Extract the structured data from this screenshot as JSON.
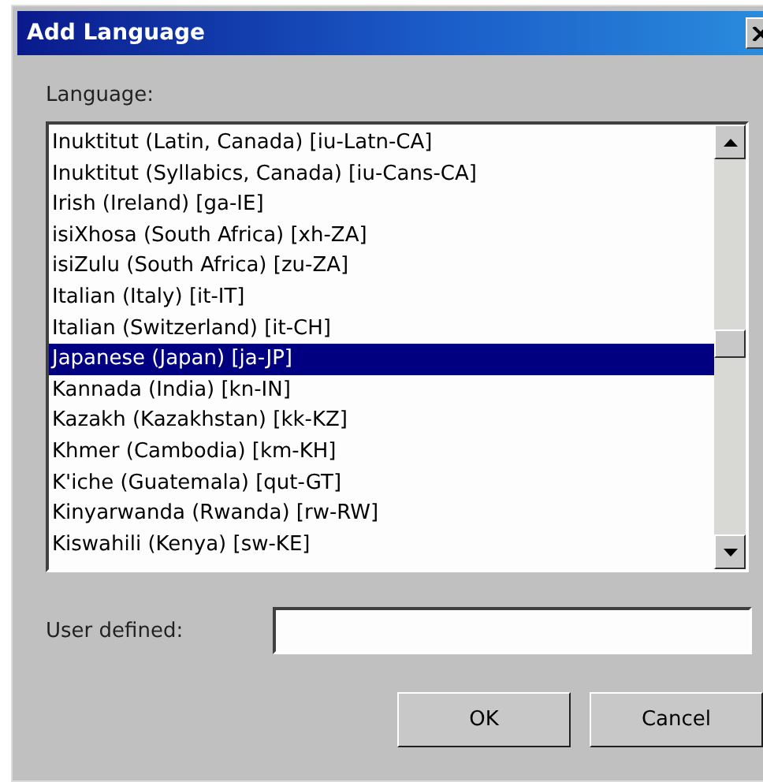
{
  "window": {
    "title": "Add Language"
  },
  "language_label": "Language:",
  "languages": [
    {
      "label": "Inuktitut (Latin, Canada) [iu-Latn-CA]",
      "selected": false
    },
    {
      "label": "Inuktitut (Syllabics, Canada) [iu-Cans-CA]",
      "selected": false
    },
    {
      "label": "Irish (Ireland) [ga-IE]",
      "selected": false
    },
    {
      "label": "isiXhosa (South Africa) [xh-ZA]",
      "selected": false
    },
    {
      "label": "isiZulu (South Africa) [zu-ZA]",
      "selected": false
    },
    {
      "label": "Italian (Italy) [it-IT]",
      "selected": false
    },
    {
      "label": "Italian (Switzerland) [it-CH]",
      "selected": false
    },
    {
      "label": "Japanese (Japan) [ja-JP]",
      "selected": true
    },
    {
      "label": "Kannada (India) [kn-IN]",
      "selected": false
    },
    {
      "label": "Kazakh (Kazakhstan) [kk-KZ]",
      "selected": false
    },
    {
      "label": "Khmer (Cambodia) [km-KH]",
      "selected": false
    },
    {
      "label": "K'iche (Guatemala) [qut-GT]",
      "selected": false
    },
    {
      "label": "Kinyarwanda (Rwanda) [rw-RW]",
      "selected": false
    },
    {
      "label": "Kiswahili (Kenya) [sw-KE]",
      "selected": false
    }
  ],
  "user_defined": {
    "label": "User defined:"
  },
  "buttons": [
    "OK",
    "Cancel"
  ]
}
